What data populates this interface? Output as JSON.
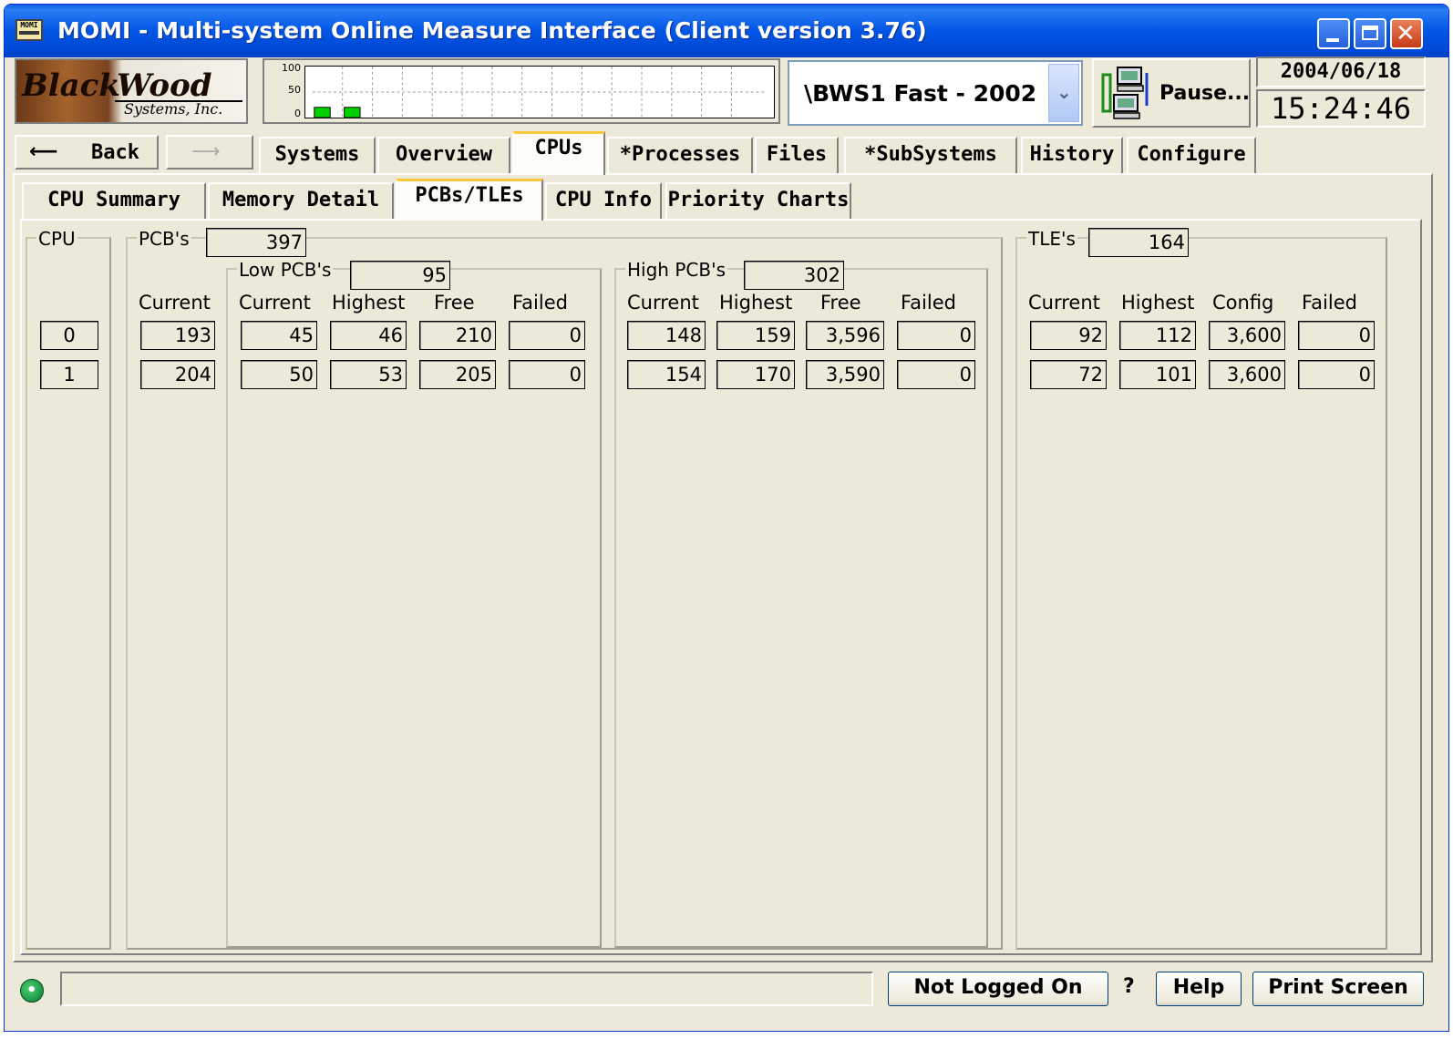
{
  "window": {
    "title": "MOMI - Multi-system Online Measure Interface (Client version 3.76)",
    "app_icon_text": "MOMI"
  },
  "toolbar": {
    "logo": {
      "line1a": "Black",
      "line1b": "Wood",
      "line2": "Systems, Inc."
    },
    "graph": {
      "y_labels": [
        "100",
        "50",
        "0"
      ],
      "bars": [
        {
          "x": 1,
          "value": 20
        },
        {
          "x": 2,
          "value": 20
        }
      ],
      "max": 100,
      "bar_color": "#00d000"
    },
    "system_select": {
      "value": "\\BWS1 Fast - 2002"
    },
    "pause_label": "Pause...",
    "date": "2004/06/18",
    "time": "15:24:46"
  },
  "nav": {
    "back_label": "Back",
    "tabs": [
      "Systems",
      "Overview",
      "CPUs",
      "*Processes",
      "Files",
      "*SubSystems",
      "History",
      "Configure"
    ],
    "selected_tab": "CPUs",
    "sub_tabs": [
      "CPU Summary",
      "Memory Detail",
      "PCBs/TLEs",
      "CPU Info",
      "Priority Charts"
    ],
    "selected_sub_tab": "PCBs/TLEs"
  },
  "content": {
    "cpu_group": {
      "label": "CPU",
      "rows": [
        "0",
        "1"
      ]
    },
    "pcb_group": {
      "label": "PCB's",
      "total": "397",
      "current_header": "Current",
      "current": [
        "193",
        "204"
      ]
    },
    "low_pcb": {
      "label": "Low PCB's",
      "total": "95",
      "headers": [
        "Current",
        "Highest",
        "Free",
        "Failed"
      ],
      "rows": [
        [
          "45",
          "46",
          "210",
          "0"
        ],
        [
          "50",
          "53",
          "205",
          "0"
        ]
      ]
    },
    "high_pcb": {
      "label": "High PCB's",
      "total": "302",
      "headers": [
        "Current",
        "Highest",
        "Free",
        "Failed"
      ],
      "rows": [
        [
          "148",
          "159",
          "3,596",
          "0"
        ],
        [
          "154",
          "170",
          "3,590",
          "0"
        ]
      ]
    },
    "tle": {
      "label": "TLE's",
      "total": "164",
      "headers": [
        "Current",
        "Highest",
        "Config",
        "Failed"
      ],
      "rows": [
        [
          "92",
          "112",
          "3,600",
          "0"
        ],
        [
          "72",
          "101",
          "3,600",
          "0"
        ]
      ]
    }
  },
  "status": {
    "message": "",
    "login_label": "Not Logged On",
    "question": "?",
    "help_label": "Help",
    "print_label": "Print Screen"
  }
}
